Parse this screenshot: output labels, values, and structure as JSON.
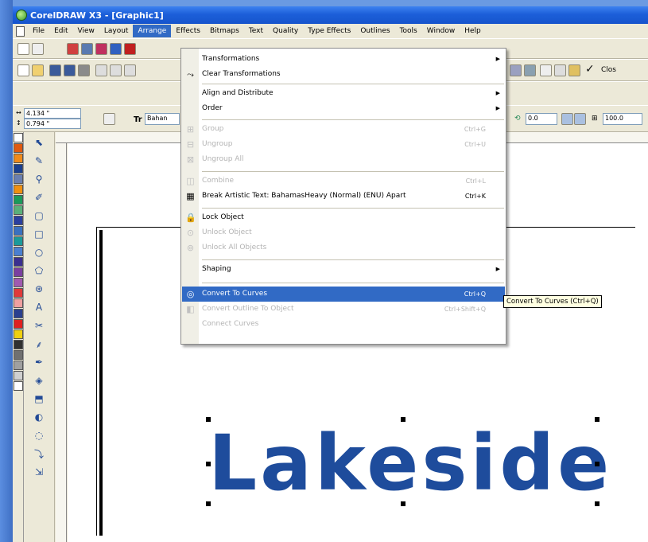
{
  "title": "CorelDRAW X3 - [Graphic1]",
  "menubar": [
    "File",
    "Edit",
    "View",
    "Layout",
    "Arrange",
    "Effects",
    "Bitmaps",
    "Text",
    "Quality",
    "Type Effects",
    "Outlines",
    "Tools",
    "Window",
    "Help"
  ],
  "active_menu": "Arrange",
  "toolbar_extra_label": "Clos",
  "propbar": {
    "width": "4.134 \"",
    "height": "0.794 \"",
    "font": "Bahan",
    "angle": "0.0",
    "scale": "100.0"
  },
  "dropdown": {
    "items": [
      {
        "label": "Transformations",
        "shortcut": "",
        "submenu": true,
        "disabled": false,
        "icon": ""
      },
      {
        "label": "Clear Transformations",
        "shortcut": "",
        "submenu": false,
        "disabled": false,
        "icon": "clear-transform-icon"
      },
      {
        "label": "Align and Distribute",
        "shortcut": "",
        "submenu": true,
        "disabled": false,
        "icon": ""
      },
      {
        "label": "Order",
        "shortcut": "",
        "submenu": true,
        "disabled": false,
        "icon": ""
      },
      {
        "label": "Group",
        "shortcut": "Ctrl+G",
        "submenu": false,
        "disabled": true,
        "icon": "group-icon"
      },
      {
        "label": "Ungroup",
        "shortcut": "Ctrl+U",
        "submenu": false,
        "disabled": true,
        "icon": "ungroup-icon"
      },
      {
        "label": "Ungroup All",
        "shortcut": "",
        "submenu": false,
        "disabled": true,
        "icon": "ungroup-all-icon"
      },
      {
        "label": "Combine",
        "shortcut": "Ctrl+L",
        "submenu": false,
        "disabled": true,
        "icon": "combine-icon"
      },
      {
        "label": "Break Artistic Text: BahamasHeavy (Normal) (ENU) Apart",
        "shortcut": "Ctrl+K",
        "submenu": false,
        "disabled": false,
        "icon": "break-apart-icon"
      },
      {
        "label": "Lock Object",
        "shortcut": "",
        "submenu": false,
        "disabled": false,
        "icon": "lock-icon"
      },
      {
        "label": "Unlock Object",
        "shortcut": "",
        "submenu": false,
        "disabled": true,
        "icon": "unlock-icon"
      },
      {
        "label": "Unlock All Objects",
        "shortcut": "",
        "submenu": false,
        "disabled": true,
        "icon": "unlock-all-icon"
      },
      {
        "label": "Shaping",
        "shortcut": "",
        "submenu": true,
        "disabled": false,
        "icon": ""
      },
      {
        "label": "Convert To Curves",
        "shortcut": "Ctrl+Q",
        "submenu": false,
        "disabled": false,
        "highlight": true,
        "icon": "convert-curves-icon"
      },
      {
        "label": "Convert Outline To Object",
        "shortcut": "Ctrl+Shift+Q",
        "submenu": false,
        "disabled": true,
        "icon": "outline-object-icon"
      },
      {
        "label": "Connect Curves",
        "shortcut": "",
        "submenu": false,
        "disabled": true,
        "icon": ""
      }
    ]
  },
  "tooltip": "Convert To Curves (Ctrl+Q)",
  "canvas_text": "Lakeside",
  "colors": {
    "accent": "#316ac5",
    "artwork": "#1e4c9c",
    "titlebar": "#1c5fd9"
  },
  "palette_colors": [
    "#ffffff",
    "#e05a10",
    "#f08a1a",
    "#1a3f8f",
    "#6a7fb0",
    "#f09010",
    "#1a9a5a",
    "#5ab07a",
    "#2a3f9f",
    "#3a70c0",
    "#1a9a9a",
    "#4a7fd0",
    "#3a2f8f",
    "#7a3fa0",
    "#a05ab0",
    "#e03a3a",
    "#f0a0a0",
    "#2a3f8f",
    "#e02020",
    "#f0d010",
    "#303030",
    "#707070",
    "#a0a0a0",
    "#d0d0d0",
    "#ffffff"
  ]
}
